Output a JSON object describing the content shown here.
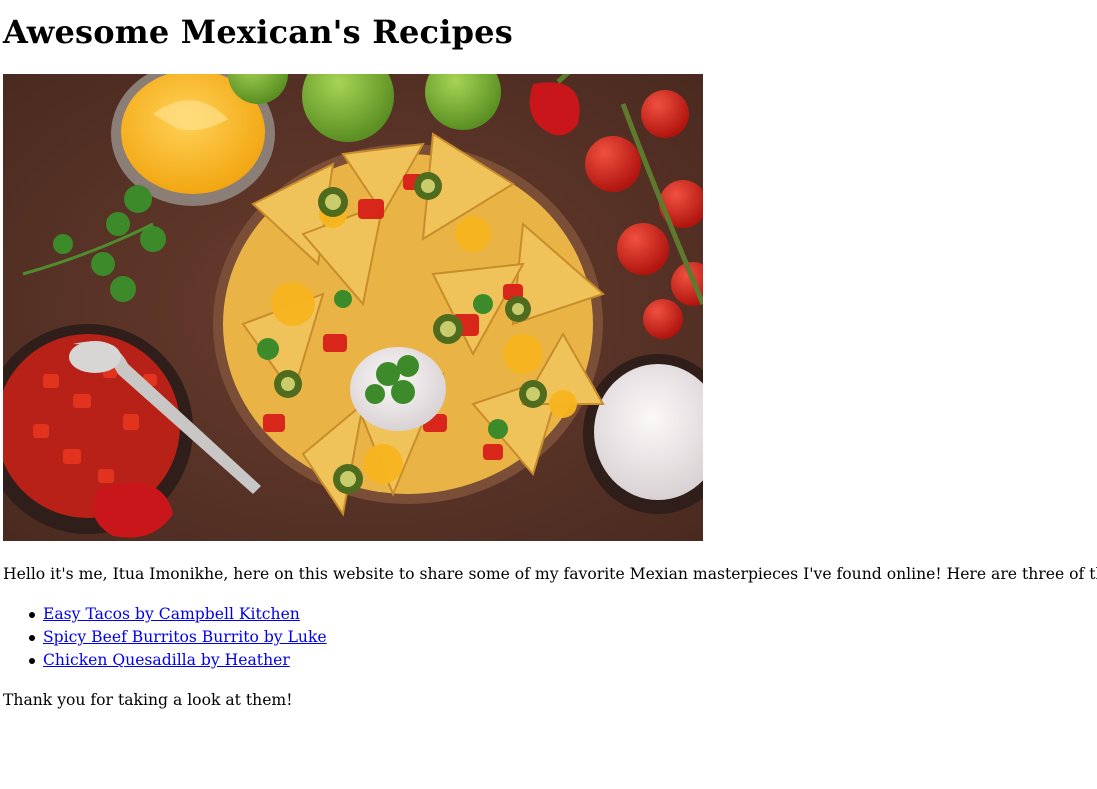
{
  "page": {
    "title": "Awesome Mexican's Recipes",
    "intro": "Hello it's me, Itua Imonikhe, here on this website to share some of my favorite Mexian masterpieces I've found online! Here are three of them:",
    "outro": "Thank you for taking a look at them!"
  },
  "hero_image": {
    "icon": "nachos-photo",
    "colors": {
      "table": "#5b3327",
      "chip": "#e8b441",
      "cheese": "#f5b21c",
      "tomato": "#d3221a",
      "lime": "#7fb43a",
      "cream": "#f2eeee",
      "bowl": "#3a2520",
      "cilantro": "#3d8a2a"
    }
  },
  "recipes": [
    {
      "label": "Easy Tacos by Campbell Kitchen"
    },
    {
      "label": "Spicy Beef Burritos Burrito by Luke"
    },
    {
      "label": "Chicken Quesadilla by Heather"
    }
  ],
  "colors": {
    "link": "#0000ee",
    "text": "#000000",
    "background": "#ffffff"
  }
}
